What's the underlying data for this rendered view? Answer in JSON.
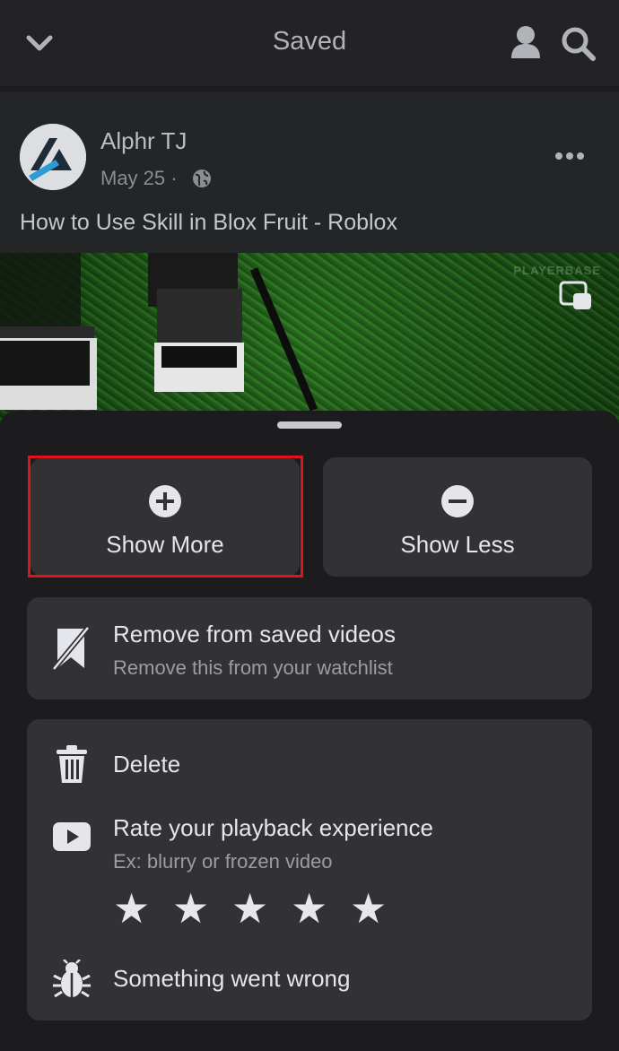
{
  "header": {
    "title": "Saved",
    "back_icon": "chevron-down-icon",
    "profile_icon": "person-icon",
    "search_icon": "search-icon"
  },
  "post": {
    "author": "Alphr TJ",
    "date": "May 25 ·",
    "privacy_icon": "globe-icon",
    "more_icon": "more-horizontal-icon",
    "text": "How to Use Skill in Blox Fruit - Roblox",
    "video_watermark": "PLAYERBASE",
    "pip_icon": "picture-in-picture-icon"
  },
  "sheet": {
    "show_more": {
      "label": "Show More",
      "icon": "plus-circle-icon"
    },
    "show_less": {
      "label": "Show Less",
      "icon": "minus-circle-icon"
    },
    "remove_saved": {
      "title": "Remove from saved videos",
      "subtitle": "Remove this from your watchlist",
      "icon": "bookmark-slash-icon"
    },
    "delete": {
      "title": "Delete",
      "icon": "trash-icon"
    },
    "rate": {
      "title": "Rate your playback experience",
      "subtitle": "Ex: blurry or frozen video",
      "icon": "play-icon",
      "stars": [
        "★",
        "★",
        "★",
        "★",
        "★"
      ]
    },
    "report": {
      "title": "Something went wrong",
      "icon": "bug-icon"
    }
  },
  "colors": {
    "highlight": "#e0121b",
    "background": "#232325",
    "sheet": "#1c1c1e",
    "card": "#323234"
  }
}
